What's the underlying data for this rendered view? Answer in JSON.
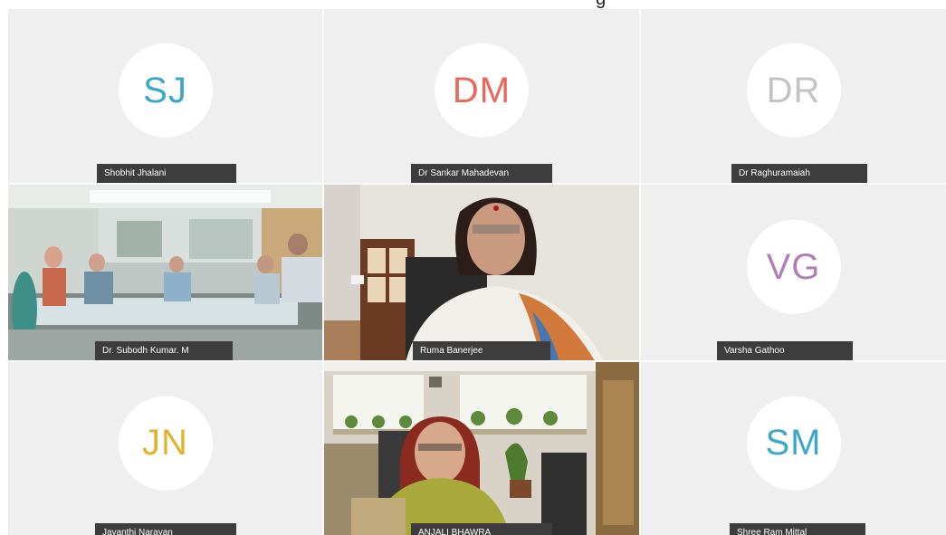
{
  "header": {
    "cut_text": "g"
  },
  "participants": [
    {
      "initials": "SJ",
      "name": "Shobhit Jhalani",
      "initials_color": "#3ba7c9",
      "has_video": false
    },
    {
      "initials": "DM",
      "name": "Dr Sankar Mahadevan",
      "initials_color": "#e8695c",
      "has_video": false
    },
    {
      "initials": "DR",
      "name": "Dr Raghuramaiah",
      "initials_color": "#c4c4c4",
      "has_video": false
    },
    {
      "initials": "",
      "name": "Dr. Subodh Kumar. M",
      "has_video": true
    },
    {
      "initials": "",
      "name": "Ruma Banerjee",
      "has_video": true
    },
    {
      "initials": "VG",
      "name": "Varsha Gathoo",
      "initials_color": "#b07fb6",
      "has_video": false
    },
    {
      "initials": "JN",
      "name": "Jayanthi Narayan",
      "initials_color": "#e0b431",
      "has_video": false
    },
    {
      "initials": "",
      "name": "ANJALI BHAWRA",
      "has_video": true
    },
    {
      "initials": "SM",
      "name": "Shree Ram Mittal",
      "initials_color": "#3ba7c9",
      "has_video": false
    }
  ],
  "colors": {
    "tile_background": "#efefef",
    "nameplate_background": "#3d3d3d",
    "nameplate_text": "#ffffff"
  }
}
